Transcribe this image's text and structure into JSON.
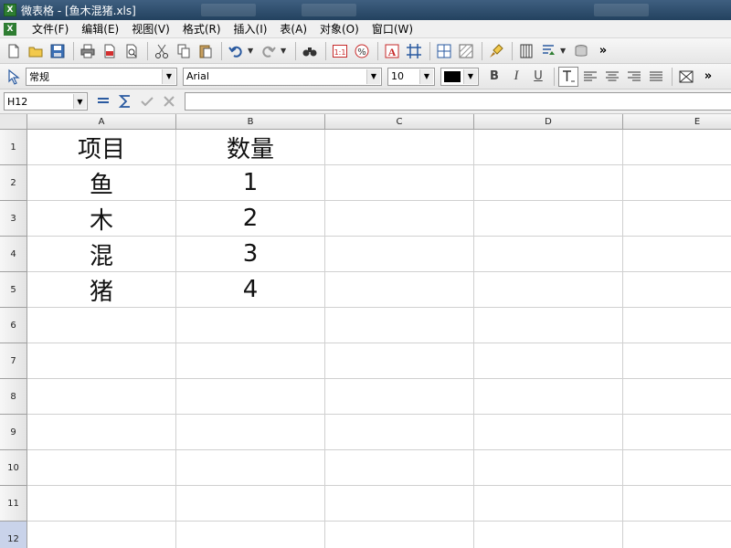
{
  "window": {
    "title": "微表格 - [鱼木混猪.xls]",
    "app_icon_letter": "X"
  },
  "menubar": {
    "items": [
      "文件(F)",
      "编辑(E)",
      "视图(V)",
      "格式(R)",
      "插入(I)",
      "表(A)",
      "对象(O)",
      "窗口(W)"
    ]
  },
  "format_toolbar": {
    "style_value": "常规",
    "font_value": "Arial",
    "size_value": "10",
    "bold_label": "B",
    "italic_label": "I",
    "underline_label": "U",
    "font_color": "#000000"
  },
  "formula_bar": {
    "cell_reference": "H12",
    "formula_value": ""
  },
  "sheet": {
    "columns": [
      {
        "letter": "A",
        "width": 163
      },
      {
        "letter": "B",
        "width": 163
      },
      {
        "letter": "C",
        "width": 163
      },
      {
        "letter": "D",
        "width": 163
      },
      {
        "letter": "E",
        "width": 163
      }
    ],
    "rows": [
      "1",
      "2",
      "3",
      "4",
      "5",
      "6",
      "7",
      "8",
      "9",
      "10",
      "11",
      "12"
    ],
    "selected_row": "12",
    "cells": {
      "A1": "项目",
      "B1": "数量",
      "A2": "鱼",
      "B2": "1",
      "A3": "木",
      "B3": "2",
      "A4": "混",
      "B4": "3",
      "A5": "猪",
      "B5": "4"
    }
  },
  "colors": {
    "title_bar": "#2f4f6f",
    "grid_line": "#d0d0d0",
    "header_bg": "#e8e8e8",
    "selected_row_header": "#c9d3ea"
  }
}
